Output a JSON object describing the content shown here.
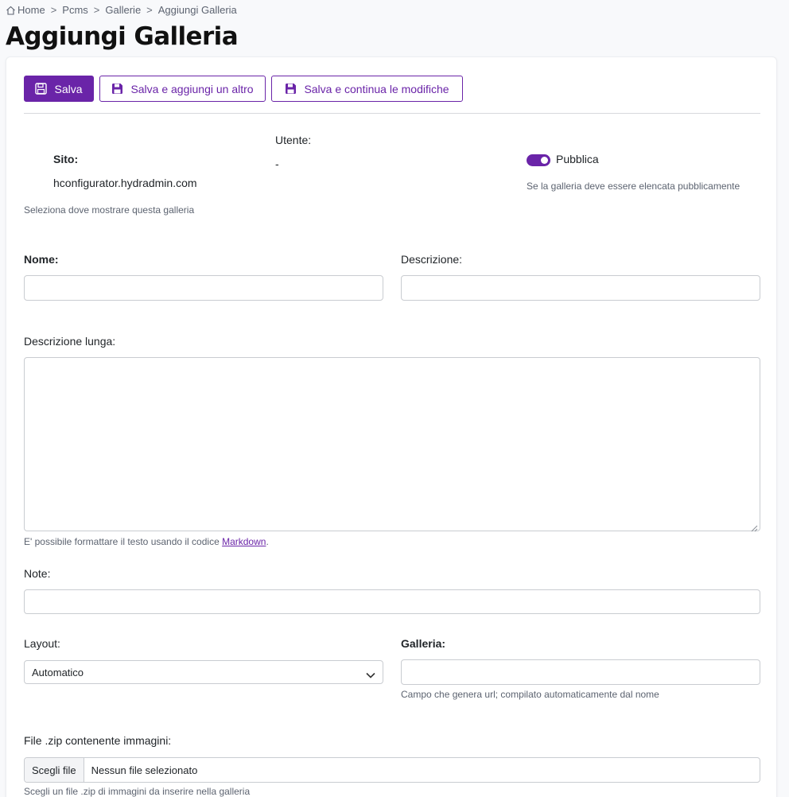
{
  "breadcrumb": {
    "items": [
      "Home",
      "Pcms",
      "Gallerie",
      "Aggiungi Galleria"
    ],
    "separator": ">"
  },
  "page": {
    "title": "Aggiungi Galleria"
  },
  "toolbar": {
    "save_label": "Salva",
    "save_add_label": "Salva e aggiungi un altro",
    "save_continue_label": "Salva e continua le modifiche"
  },
  "form": {
    "sito": {
      "label": "Sito:",
      "value": "hconfigurator.hydradmin.com",
      "help": "Seleziona dove mostrare questa galleria"
    },
    "utente": {
      "label": "Utente:",
      "value": "-"
    },
    "pubblica": {
      "label": "Pubblica",
      "checked": true,
      "help": "Se la galleria deve essere elencata pubblicamente"
    },
    "nome": {
      "label": "Nome:",
      "value": ""
    },
    "descrizione": {
      "label": "Descrizione:",
      "value": ""
    },
    "descrizione_lunga": {
      "label": "Descrizione lunga:",
      "value": "",
      "help_prefix": "E' possibile formattare il testo usando il codice ",
      "help_link": "Markdown",
      "help_suffix": "."
    },
    "note": {
      "label": "Note:",
      "value": ""
    },
    "layout": {
      "label": "Layout:",
      "selected": "Automatico"
    },
    "galleria": {
      "label": "Galleria:",
      "value": "",
      "help": "Campo che genera url; compilato automaticamente dal nome"
    },
    "file_zip": {
      "label": "File .zip contenente immagini:",
      "button_label": "Scegli file",
      "status": "Nessun file selezionato",
      "help": "Scegli un file .zip di immagini da inserire nella galleria"
    }
  },
  "colors": {
    "accent": "#6a24a8",
    "border": "#c9ccd1",
    "muted_text": "#5c6370"
  },
  "icons": {
    "home": "home-icon",
    "save": "floppy-disk-icon",
    "select_arrow": "chevron-down-icon"
  }
}
